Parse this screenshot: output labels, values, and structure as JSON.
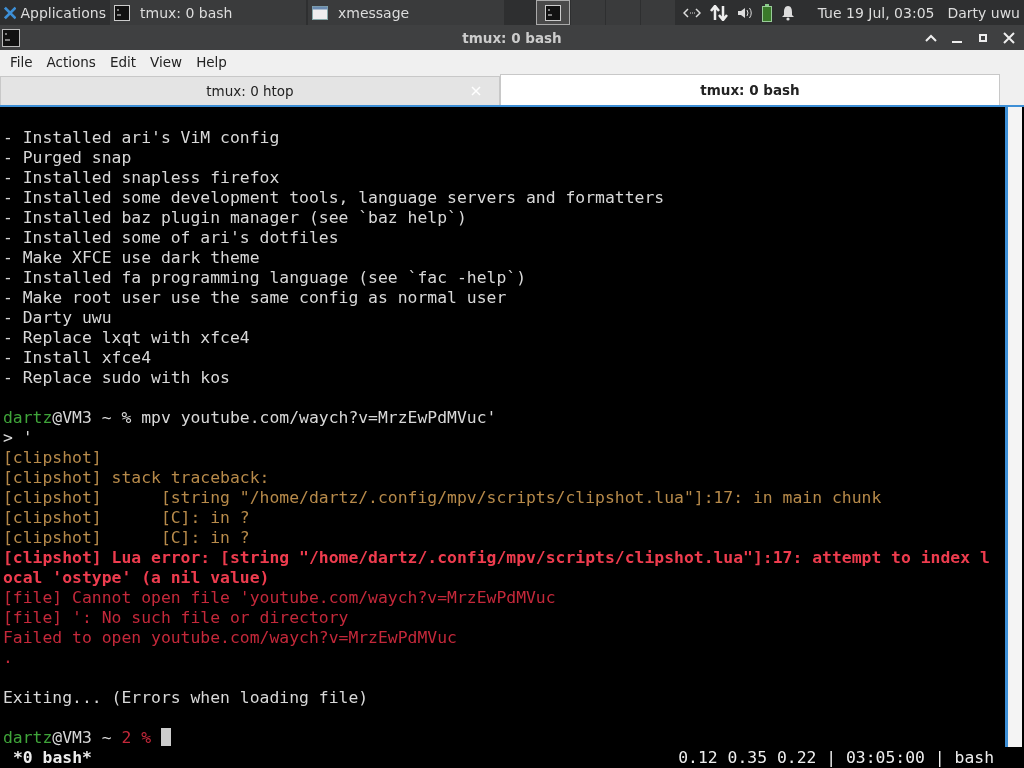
{
  "taskbar": {
    "apps_label": "Applications",
    "tasks": [
      {
        "title": "tmux: 0 bash",
        "kind": "terminal",
        "selected": false
      },
      {
        "title": "xmessage",
        "kind": "window",
        "selected": false
      }
    ],
    "workspaces": [
      {
        "selected": true
      },
      {
        "selected": false
      },
      {
        "selected": false
      },
      {
        "selected": false
      }
    ],
    "clock": "Tue 19 Jul, 03:05",
    "user": "Darty uwu"
  },
  "window": {
    "title": "tmux: 0 bash"
  },
  "menu": [
    "File",
    "Actions",
    "Edit",
    "View",
    "Help"
  ],
  "tabs": [
    {
      "label": "tmux: 0 htop",
      "selected": false
    },
    {
      "label": "tmux: 0 bash",
      "selected": true
    }
  ],
  "terminal": {
    "lines": [
      {
        "segments": [
          {
            "text": "- Installed ari's ViM config",
            "kind": "plain"
          }
        ],
        "blank_before": true
      },
      {
        "segments": [
          {
            "text": "- Purged snap",
            "kind": "plain"
          }
        ]
      },
      {
        "segments": [
          {
            "text": "- Installed snapless firefox",
            "kind": "plain"
          }
        ]
      },
      {
        "segments": [
          {
            "text": "- Installed some development tools, language servers and formatters",
            "kind": "plain"
          }
        ]
      },
      {
        "segments": [
          {
            "text": "- Installed baz plugin manager (see `baz help`)",
            "kind": "plain"
          }
        ]
      },
      {
        "segments": [
          {
            "text": "- Installed some of ari's dotfiles",
            "kind": "plain"
          }
        ]
      },
      {
        "segments": [
          {
            "text": "- Make XFCE use dark theme",
            "kind": "plain"
          }
        ]
      },
      {
        "segments": [
          {
            "text": "- Installed fa programming language (see `fac -help`)",
            "kind": "plain"
          }
        ]
      },
      {
        "segments": [
          {
            "text": "- Make root user use the same config as normal user",
            "kind": "plain"
          }
        ]
      },
      {
        "segments": [
          {
            "text": "- Darty uwu",
            "kind": "plain"
          }
        ]
      },
      {
        "segments": [
          {
            "text": "- Replace lxqt with xfce4",
            "kind": "plain"
          }
        ]
      },
      {
        "segments": [
          {
            "text": "- Install xfce4",
            "kind": "plain"
          }
        ]
      },
      {
        "segments": [
          {
            "text": "- Replace sudo with kos",
            "kind": "plain"
          }
        ]
      },
      {
        "segments": [
          {
            "text": "dartz",
            "kind": "user"
          },
          {
            "text": "@VM3 ~ % mpv youtube.com/waych?v=MrzEwPdMVuc'",
            "kind": "plain"
          }
        ],
        "blank_before": true
      },
      {
        "segments": [
          {
            "text": "> '",
            "kind": "plain"
          }
        ]
      },
      {
        "segments": [
          {
            "text": "[clipshot]",
            "kind": "warn"
          }
        ]
      },
      {
        "segments": [
          {
            "text": "[clipshot] stack traceback:",
            "kind": "warn"
          }
        ]
      },
      {
        "segments": [
          {
            "text": "[clipshot]      [string \"/home/dartz/.config/mpv/scripts/clipshot.lua\"]:17: in main chunk",
            "kind": "warn"
          }
        ]
      },
      {
        "segments": [
          {
            "text": "[clipshot]      [C]: in ?",
            "kind": "warn"
          }
        ]
      },
      {
        "segments": [
          {
            "text": "[clipshot]      [C]: in ?",
            "kind": "warn"
          }
        ]
      },
      {
        "segments": [
          {
            "text": "[clipshot] Lua error: [string \"/home/dartz/.config/mpv/scripts/clipshot.lua\"]:17: attempt to index l",
            "kind": "fatal"
          }
        ]
      },
      {
        "segments": [
          {
            "text": "ocal 'ostype' (a nil value)",
            "kind": "fatal"
          }
        ]
      },
      {
        "segments": [
          {
            "text": "[file] Cannot open file 'youtube.com/waych?v=MrzEwPdMVuc",
            "kind": "error"
          }
        ]
      },
      {
        "segments": [
          {
            "text": "[file] ': No such file or directory",
            "kind": "error"
          }
        ]
      },
      {
        "segments": [
          {
            "text": "Failed to open youtube.com/waych?v=MrzEwPdMVuc",
            "kind": "error"
          }
        ]
      },
      {
        "segments": [
          {
            "text": ".",
            "kind": "error"
          }
        ]
      },
      {
        "segments": [
          {
            "text": "Exiting... (Errors when loading file)",
            "kind": "plain"
          }
        ],
        "blank_before": true
      },
      {
        "segments": [
          {
            "text": "dartz",
            "kind": "user"
          },
          {
            "text": "@VM3 ~ ",
            "kind": "plain"
          },
          {
            "text": "2 %",
            "kind": "error"
          }
        ],
        "cursor": true,
        "blank_before": true
      }
    ]
  },
  "status_bar": {
    "left": "*0 bash*",
    "right": "0.12 0.35 0.22 | 03:05:00 | bash"
  }
}
